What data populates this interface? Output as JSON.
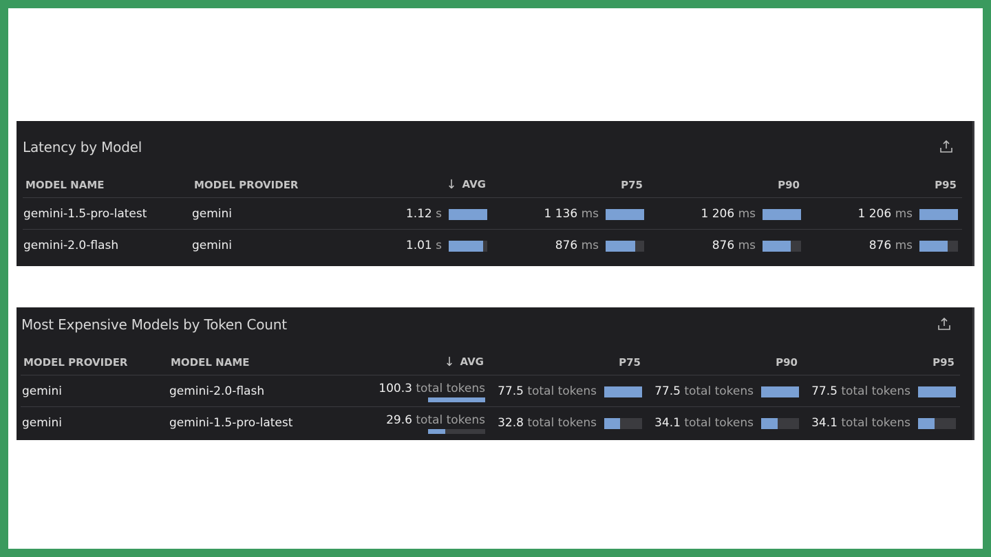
{
  "latency": {
    "title": "Latency by Model",
    "export_icon": "share-upload-icon",
    "headers": {
      "model_name": "MODEL NAME",
      "model_provider": "MODEL PROVIDER",
      "sort_icon": "arrow-down-icon",
      "avg": "AVG",
      "p75": "P75",
      "p90": "P90",
      "p95": "P95"
    },
    "rows": [
      {
        "model_name": "gemini-1.5-pro-latest",
        "model_provider": "gemini",
        "avg": {
          "value": "1.12",
          "unit": "s",
          "fraction": 1.0
        },
        "p75": {
          "value": "1 136",
          "unit": "ms",
          "fraction": 1.0
        },
        "p90": {
          "value": "1 206",
          "unit": "ms",
          "fraction": 1.0
        },
        "p95": {
          "value": "1 206",
          "unit": "ms",
          "fraction": 1.0
        }
      },
      {
        "model_name": "gemini-2.0-flash",
        "model_provider": "gemini",
        "avg": {
          "value": "1.01",
          "unit": "s",
          "fraction": 0.9
        },
        "p75": {
          "value": "876",
          "unit": "ms",
          "fraction": 0.77
        },
        "p90": {
          "value": "876",
          "unit": "ms",
          "fraction": 0.73
        },
        "p95": {
          "value": "876",
          "unit": "ms",
          "fraction": 0.73
        }
      }
    ]
  },
  "tokens": {
    "title": "Most Expensive Models by Token Count",
    "export_icon": "share-upload-icon",
    "headers": {
      "model_provider": "MODEL PROVIDER",
      "model_name": "MODEL NAME",
      "sort_icon": "arrow-down-icon",
      "avg": "AVG",
      "p75": "P75",
      "p90": "P90",
      "p95": "P95"
    },
    "rows": [
      {
        "model_provider": "gemini",
        "model_name": "gemini-2.0-flash",
        "avg": {
          "value": "100.3",
          "unit": "total tokens",
          "fraction": 1.0
        },
        "p75": {
          "value": "77.5",
          "unit": "total tokens",
          "fraction": 1.0
        },
        "p90": {
          "value": "77.5",
          "unit": "total tokens",
          "fraction": 1.0
        },
        "p95": {
          "value": "77.5",
          "unit": "total tokens",
          "fraction": 1.0
        }
      },
      {
        "model_provider": "gemini",
        "model_name": "gemini-1.5-pro-latest",
        "avg": {
          "value": "29.6",
          "unit": "total tokens",
          "fraction": 0.3
        },
        "p75": {
          "value": "32.8",
          "unit": "total tokens",
          "fraction": 0.42
        },
        "p90": {
          "value": "34.1",
          "unit": "total tokens",
          "fraction": 0.44
        },
        "p95": {
          "value": "34.1",
          "unit": "total tokens",
          "fraction": 0.44
        }
      }
    ]
  },
  "colors": {
    "panel_bg": "#1f1f22",
    "bar_fill": "#7aa0d4",
    "bar_track": "#3b3b3f",
    "frame": "#3a9a5e"
  }
}
